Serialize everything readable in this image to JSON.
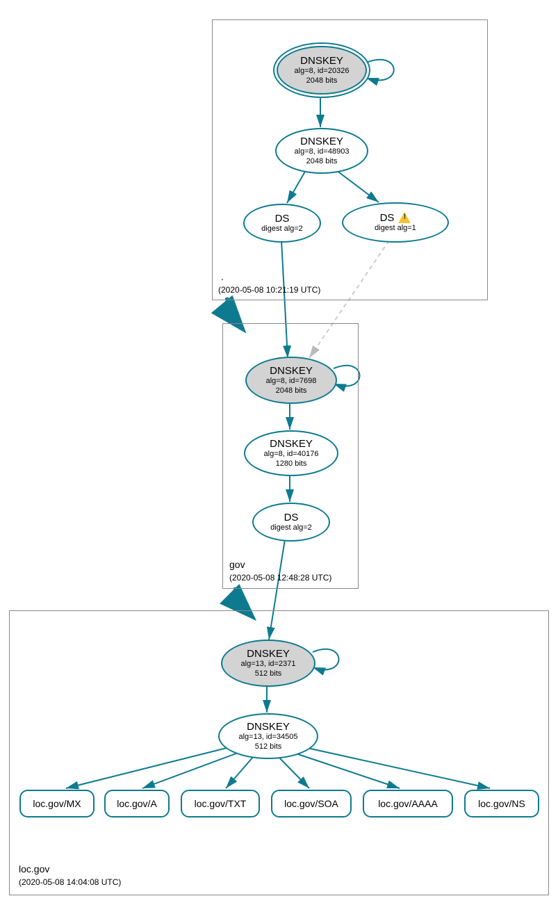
{
  "zones": {
    "root": {
      "label": ".",
      "timestamp": "(2020-05-08 10:21:19 UTC)"
    },
    "gov": {
      "label": "gov",
      "timestamp": "(2020-05-08 12:48:28 UTC)"
    },
    "locgov": {
      "label": "loc.gov",
      "timestamp": "(2020-05-08 14:04:08 UTC)"
    }
  },
  "nodes": {
    "root_ksk": {
      "title": "DNSKEY",
      "line1": "alg=8, id=20326",
      "line2": "2048 bits"
    },
    "root_zsk": {
      "title": "DNSKEY",
      "line1": "alg=8, id=48903",
      "line2": "2048 bits"
    },
    "root_ds2": {
      "title": "DS",
      "line1": "digest alg=2"
    },
    "root_ds1": {
      "title": "DS",
      "line1": "digest alg=1",
      "warn": true
    },
    "gov_ksk": {
      "title": "DNSKEY",
      "line1": "alg=8, id=7698",
      "line2": "2048 bits"
    },
    "gov_zsk": {
      "title": "DNSKEY",
      "line1": "alg=8, id=40176",
      "line2": "1280 bits"
    },
    "gov_ds": {
      "title": "DS",
      "line1": "digest alg=2"
    },
    "loc_ksk": {
      "title": "DNSKEY",
      "line1": "alg=13, id=2371",
      "line2": "512 bits"
    },
    "loc_zsk": {
      "title": "DNSKEY",
      "line1": "alg=13, id=34505",
      "line2": "512 bits"
    }
  },
  "rrsets": {
    "mx": "loc.gov/MX",
    "a": "loc.gov/A",
    "txt": "loc.gov/TXT",
    "soa": "loc.gov/SOA",
    "aaaa": "loc.gov/AAAA",
    "ns": "loc.gov/NS"
  }
}
